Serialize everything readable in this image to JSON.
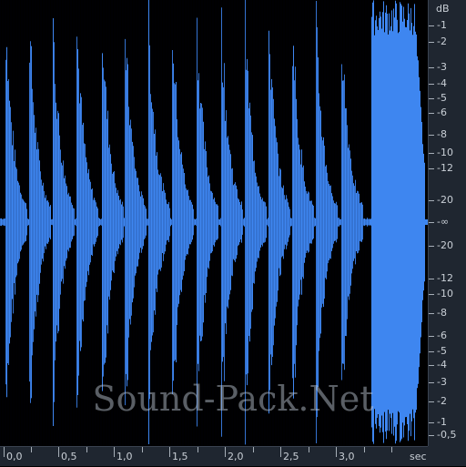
{
  "colors": {
    "waveform": "#3e86f0",
    "background": "#000000",
    "ruler": "#1f2630",
    "ruler_text": "#c9cfd6"
  },
  "db_ruler": {
    "unit": "dB",
    "labels": [
      "-1",
      "-2",
      "-3",
      "-4",
      "-5",
      "-6",
      "-8",
      "-10",
      "-12",
      "-20",
      "-∞",
      "-20",
      "-12",
      "-10",
      "-8",
      "-6",
      "-5",
      "-4",
      "-3",
      "-2",
      "-1",
      "-0,5"
    ]
  },
  "time_ruler": {
    "labels": [
      "0,0",
      "0,5",
      "1,0",
      "1,5",
      "2,0",
      "2,5",
      "3,0"
    ],
    "unit": "sec"
  },
  "watermark": "Sound-Pack.Net"
}
